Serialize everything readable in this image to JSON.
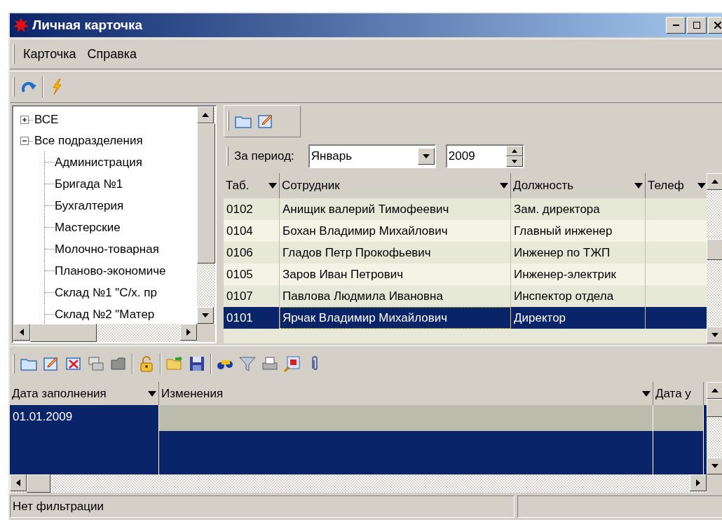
{
  "window": {
    "title": "Личная карточка"
  },
  "menu": [
    "Карточка",
    "Справка"
  ],
  "tree": [
    {
      "label": "ВСЕ",
      "expanded": false
    },
    {
      "label": "Все подразделения",
      "expanded": true,
      "children": [
        {
          "label": "Администрация"
        },
        {
          "label": "Бригада №1"
        },
        {
          "label": "Бухгалтерия"
        },
        {
          "label": "Мастерские"
        },
        {
          "label": "Молочно-товарная"
        },
        {
          "label": "Планово-экономиче"
        },
        {
          "label": "Склад №1 \"С/х. пр"
        },
        {
          "label": "Склад №2 \"Матер"
        }
      ]
    }
  ],
  "period": {
    "label": "За период:",
    "month": "Январь",
    "year": "2009"
  },
  "employees": {
    "columns": [
      "Таб.",
      "Сотрудник",
      "Должность",
      "Телеф"
    ],
    "rows": [
      {
        "cells": [
          "0102",
          "Анищик  валерий  Тимофеевич",
          "Зам. директора"
        ],
        "selected": false
      },
      {
        "cells": [
          "0104",
          "Бохан  Владимир  Михайлович",
          "Главный инженер"
        ],
        "selected": false
      },
      {
        "cells": [
          "0106",
          "Гладов  Петр  Прокофьевич",
          "Инженер по ТЖП"
        ],
        "selected": false
      },
      {
        "cells": [
          "0105",
          "Заров  Иван  Петрович",
          "Инженер-электрик"
        ],
        "selected": false
      },
      {
        "cells": [
          "0107",
          "Павлова  Людмила  Ивановна",
          "Инспектор отдела"
        ],
        "selected": false
      },
      {
        "cells": [
          "0101",
          "Ярчак  Владимир  Михайлович",
          "Директор"
        ],
        "selected": true
      }
    ]
  },
  "records": {
    "columns": [
      "Дата заполнения",
      "Изменения",
      "Дата у"
    ],
    "rows": [
      {
        "cells": [
          "01.01.2009"
        ],
        "selected": true
      }
    ]
  },
  "status_bar": "Нет фильтрации"
}
